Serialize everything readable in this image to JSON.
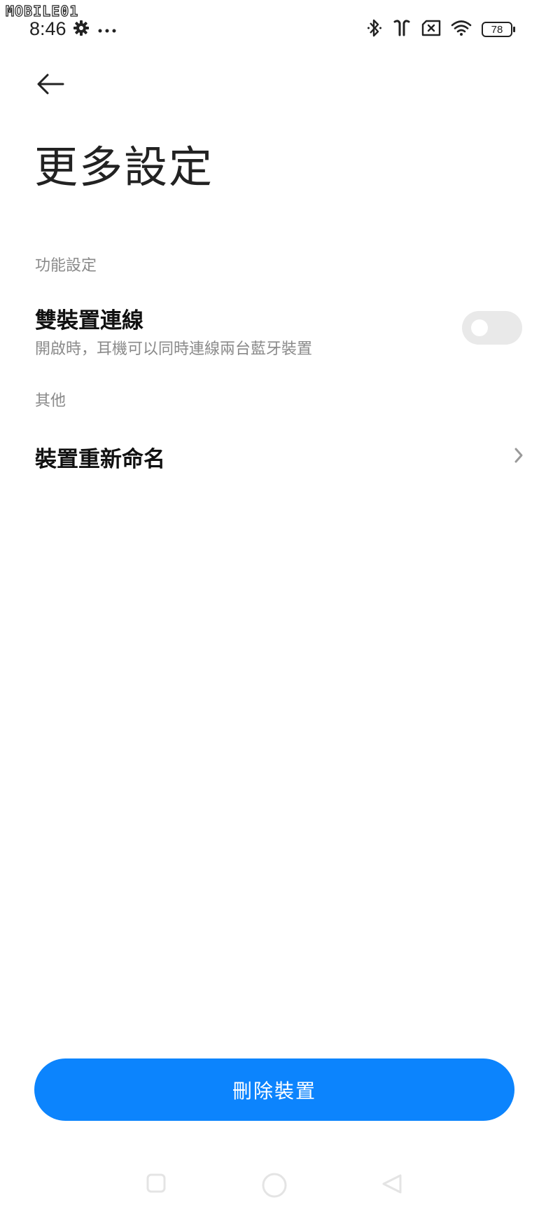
{
  "watermark": "MOBILE01",
  "status_bar": {
    "time": "8:46",
    "battery_level": "78",
    "icons_left": [
      "gear-icon",
      "more-dots-icon"
    ],
    "icons_right": [
      "bluetooth-icon",
      "earbuds-icon",
      "no-sim-icon",
      "wifi-icon",
      "battery-icon"
    ]
  },
  "header": {
    "back_icon": "arrow-left-icon",
    "title": "更多設定"
  },
  "sections": {
    "function": {
      "label": "功能設定",
      "dual_device": {
        "title": "雙裝置連線",
        "subtitle": "開啟時，耳機可以同時連線兩台藍牙裝置",
        "enabled": false
      }
    },
    "other": {
      "label": "其他",
      "rename": {
        "title": "裝置重新命名",
        "icon": "chevron-right-icon"
      }
    }
  },
  "footer": {
    "delete_label": "刪除裝置",
    "accent_color": "#0c84fd"
  },
  "nav_bar": {
    "icons": [
      "recents-square-icon",
      "home-circle-icon",
      "back-triangle-icon"
    ]
  }
}
